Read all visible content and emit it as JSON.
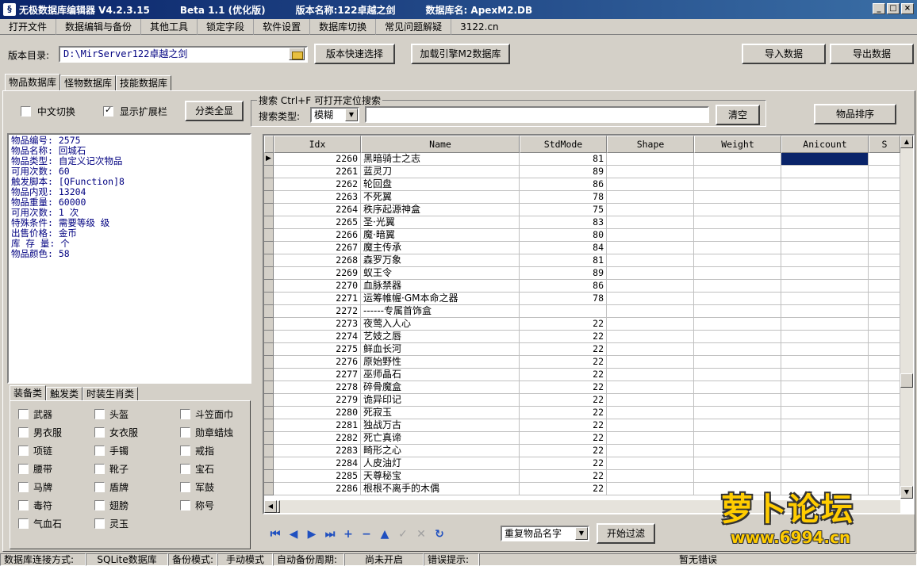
{
  "window": {
    "title_segments": [
      "无极数据库编辑器 V4.2.3.15",
      "Beta 1.1 (优化版)",
      "版本名称:122卓越之剑",
      "数据库名: ApexM2.DB"
    ]
  },
  "menu": [
    "打开文件",
    "数据编辑与备份",
    "其他工具",
    "锁定字段",
    "软件设置",
    "数据库切换",
    "常见问题解疑",
    "3122.cn"
  ],
  "path_row": {
    "label": "版本目录:",
    "path_value": "D:\\MirServer122卓越之剑",
    "quick_select": "版本快速选择",
    "load_engine": "加载引擎M2数据库",
    "import": "导入数据",
    "export": "导出数据"
  },
  "tabs": [
    "物品数据库",
    "怪物数据库",
    "技能数据库"
  ],
  "options": {
    "chinese_toggle": "中文切换",
    "show_extension": "显示扩展栏",
    "show_all": "分类全显"
  },
  "search": {
    "group_title": "搜索  Ctrl+F 可打开定位搜索",
    "type_label": "搜索类型:",
    "type_value": "模糊",
    "query": "",
    "clear": "清空",
    "sort": "物品排序"
  },
  "info_lines": [
    "物品编号: 2575",
    "物品名称: 回城石",
    "物品类型: 自定义记次物品",
    "可用次数: 60",
    "触发脚本: [QFunction]8",
    "物品内观: 13204",
    "物品重量: 60000",
    "可用次数: 1 次",
    "特殊条件: 需要等级  级",
    "出售价格: 金币",
    "库 存 量: 个",
    "物品颜色: 58"
  ],
  "subtabs": [
    "装备类",
    "触发类",
    "时装生肖类"
  ],
  "categories": [
    [
      "武器",
      "头盔",
      "斗笠面巾"
    ],
    [
      "男衣服",
      "女衣服",
      "勋章蜡烛"
    ],
    [
      "项链",
      "手镯",
      "戒指"
    ],
    [
      "腰带",
      "靴子",
      "宝石"
    ],
    [
      "马牌",
      "盾牌",
      "军鼓"
    ],
    [
      "毒符",
      "翅膀",
      "称号"
    ],
    [
      "气血石",
      "灵玉",
      ""
    ]
  ],
  "grid": {
    "columns": [
      "Idx",
      "Name",
      "StdMode",
      "Shape",
      "Weight",
      "Anicount",
      "S"
    ],
    "rows": [
      [
        "2260",
        "黑暗骑士之志",
        "81"
      ],
      [
        "2261",
        "蓝灵刀",
        "89"
      ],
      [
        "2262",
        "轮回盘",
        "86"
      ],
      [
        "2263",
        "不死翼",
        "78"
      ],
      [
        "2264",
        "秩序起源神盒",
        "75"
      ],
      [
        "2265",
        "圣·光翼",
        "83"
      ],
      [
        "2266",
        "魔·暗翼",
        "80"
      ],
      [
        "2267",
        "魔主传承",
        "84"
      ],
      [
        "2268",
        "森罗万象",
        "81"
      ],
      [
        "2269",
        "蚁王令",
        "89"
      ],
      [
        "2270",
        "血脉禁器",
        "86"
      ],
      [
        "2271",
        "运筹帷幄·GM本命之器",
        "78"
      ],
      [
        "2272",
        "------专属首饰盒",
        ""
      ],
      [
        "2273",
        "夜莺入人心",
        "22"
      ],
      [
        "2274",
        "艺妓之唇",
        "22"
      ],
      [
        "2275",
        "鲜血长河",
        "22"
      ],
      [
        "2276",
        "原始野性",
        "22"
      ],
      [
        "2277",
        "巫师晶石",
        "22"
      ],
      [
        "2278",
        "碎骨魔盒",
        "22"
      ],
      [
        "2279",
        "诡异印记",
        "22"
      ],
      [
        "2280",
        "死寂玉",
        "22"
      ],
      [
        "2281",
        "独战万古",
        "22"
      ],
      [
        "2282",
        "死亡真谛",
        "22"
      ],
      [
        "2283",
        "畸形之心",
        "22"
      ],
      [
        "2284",
        "人皮油灯",
        "22"
      ],
      [
        "2285",
        "天尊秘宝",
        "22"
      ],
      [
        "2286",
        "根根不离手的木偶",
        "22"
      ]
    ]
  },
  "filter": {
    "select_value": "重复物品名字",
    "start": "开始过滤"
  },
  "status": [
    "数据库连接方式:",
    "SQLite数据库",
    "备份模式:",
    "手动模式",
    "自动备份周期:",
    "尚未开启",
    "错误提示:",
    "暂无错误"
  ],
  "watermark": {
    "title": "萝卜论坛",
    "url": "www.6994.cn"
  },
  "colors": {
    "title_bar": "#0a246a",
    "selection": "#0a246a",
    "info_text": "#000080",
    "watermark": "#ffcc00"
  }
}
